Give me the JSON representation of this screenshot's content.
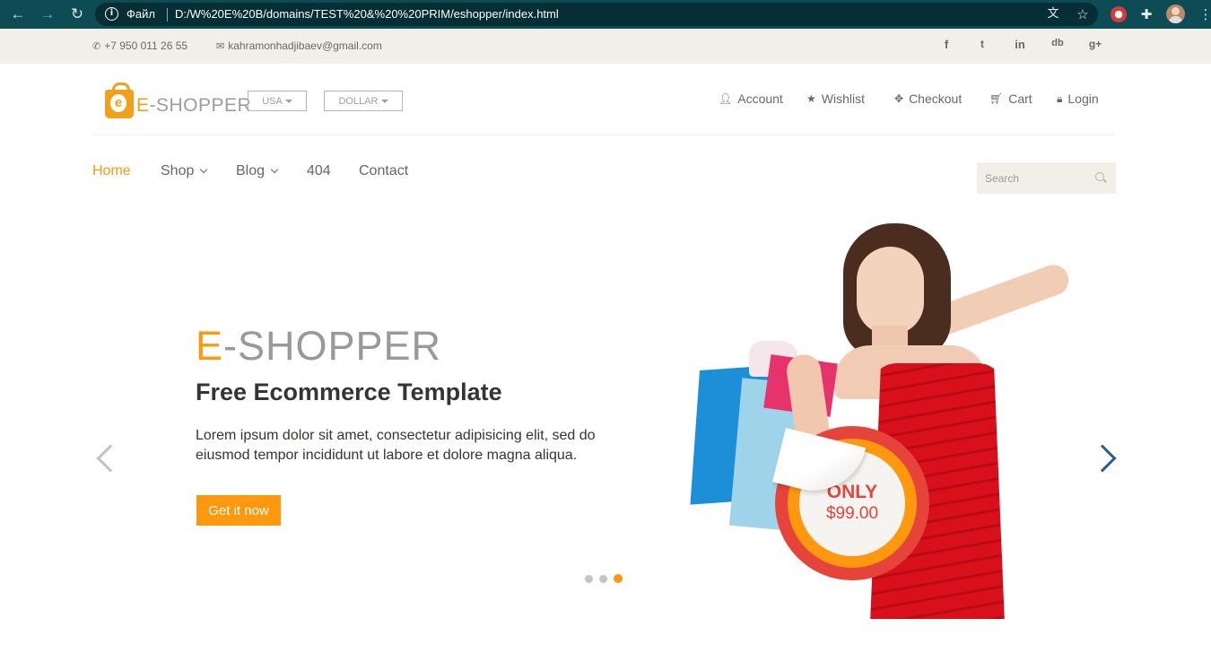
{
  "browser": {
    "scheme_label": "Файл",
    "url": "D:/W%20E%20B/domains/TEST%20&%20%20PRIM/eshopper/index.html"
  },
  "topbar": {
    "phone": "+7 950 011 26 55",
    "email": "kahramonhadjibaev@gmail.com",
    "social": [
      "f",
      "t",
      "in",
      "db",
      "g+"
    ]
  },
  "header": {
    "logo_e": "e",
    "logo_word_accent": "E",
    "logo_word_rest": "-SHOPPER",
    "country": "USA",
    "currency": "DOLLAR",
    "user_menu": [
      "Account",
      "Wishlist",
      "Checkout",
      "Cart",
      "Login"
    ]
  },
  "nav": {
    "items": [
      "Home",
      "Shop",
      "Blog",
      "404",
      "Contact"
    ],
    "active": "Home",
    "search_placeholder": "Search"
  },
  "slider": {
    "title_accent": "E",
    "title_rest": "-SHOPPER",
    "subtitle": "Free Ecommerce Template",
    "description": "Lorem ipsum dolor sit amet, consectetur adipisicing elit, sed do eiusmod tempor incididunt ut labore et dolore magna aliqua.",
    "cta": "Get it now",
    "badge_top": "ONLY",
    "badge_price": "$99.00",
    "slides": 3,
    "active_slide": 3
  },
  "colors": {
    "accent": "#fe980f",
    "chrome": "#0d4b55",
    "badge_red": "#e6433b",
    "next_arrow": "#2b5e8b"
  }
}
